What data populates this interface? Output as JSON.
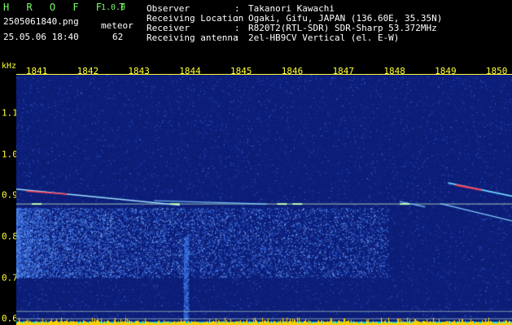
{
  "header": {
    "app_name": "H R O F F T",
    "version": "1.0.0",
    "file_name": "2505061840.png",
    "datetime": "25.05.06 18:40",
    "meteor_label": "meteor",
    "meteor_count": "62",
    "info": [
      {
        "label": "Observer",
        "sep": ":",
        "value": "Takanori Kawachi"
      },
      {
        "label": "Receiving Location",
        "sep": ":",
        "value": "Ogaki, Gifu, JAPAN (136.60E, 35.35N)"
      },
      {
        "label": "Receiver",
        "sep": ":",
        "value": "R820T2(RTL-SDR) SDR-Sharp 53.372MHz"
      },
      {
        "label": "Receiving antenna",
        "sep": ":",
        "value": "2el-HB9CV Vertical (el. E-W)"
      }
    ]
  },
  "chart_data": {
    "type": "heatmap",
    "ylabel": "kHz",
    "x_ticks": [
      "1841",
      "1842",
      "1843",
      "1844",
      "1845",
      "1846",
      "1847",
      "1848",
      "1849",
      "1850"
    ],
    "y_ticks": [
      "1.1",
      "1.0",
      "0.9",
      "0.8",
      "0.7",
      "0.6"
    ],
    "xlim": [
      1840.6,
      1850.3
    ],
    "ylim": [
      0.585,
      1.195
    ],
    "colors": {
      "background": "#0c1d78",
      "noise_low": "#1a3aa8",
      "noise_high": "#3c78e8",
      "carrier": "#d8ffd0",
      "meteor": "#ff3c50",
      "bottom_band": "#ffd000",
      "bottom_band_edge": "#00d8ff"
    }
  }
}
